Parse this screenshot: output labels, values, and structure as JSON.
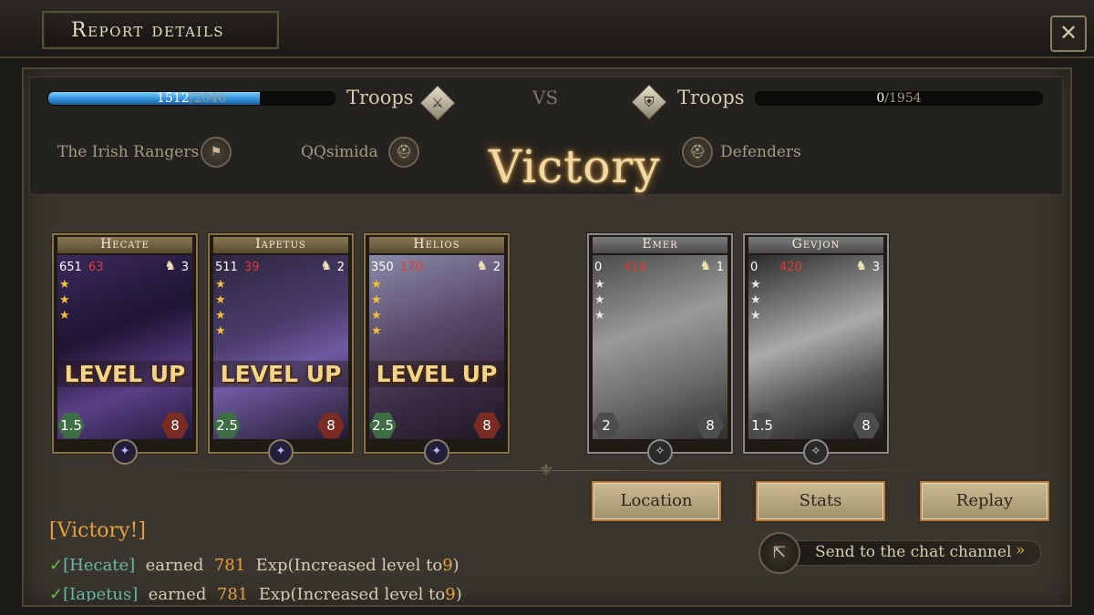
{
  "header": {
    "title": "Report details",
    "close": "✕"
  },
  "battle": {
    "left": {
      "troops_current": "1512",
      "troops_max": "/2046",
      "troops_fraction": 0.739,
      "label": "Troops",
      "icon": "sword-icon"
    },
    "vs": "VS",
    "right": {
      "troops_current": "0",
      "troops_max": "/1954",
      "troops_fraction": 0,
      "label": "Troops",
      "icon": "shield-icon"
    },
    "attacker_guild": "The Irish Rangers",
    "attacker_player": "QQsimida",
    "defender": "Defenders",
    "result": "Victory"
  },
  "cards": [
    {
      "name": "Hecate",
      "hp": "651",
      "loss": "63",
      "count": "3",
      "stars": 3,
      "left_badge": "1.5",
      "right_badge": "8",
      "level_up": "LEVEL UP",
      "gray": false
    },
    {
      "name": "Iapetus",
      "hp": "511",
      "loss": "39",
      "count": "2",
      "stars": 4,
      "left_badge": "2.5",
      "right_badge": "8",
      "level_up": "LEVEL UP",
      "gray": false
    },
    {
      "name": "Helios",
      "hp": "350",
      "loss": "170",
      "count": "2",
      "stars": 4,
      "left_badge": "2.5",
      "right_badge": "8",
      "level_up": "LEVEL UP",
      "gray": false
    },
    {
      "name": "Emer",
      "hp": "0",
      "loss": "414",
      "count": "1",
      "stars": 3,
      "left_badge": "2",
      "right_badge": "8",
      "level_up": "",
      "gray": true
    },
    {
      "name": "Gevjon",
      "hp": "0",
      "loss": "420",
      "count": "3",
      "stars": 3,
      "left_badge": "1.5",
      "right_badge": "8",
      "level_up": "",
      "gray": true
    }
  ],
  "buttons": {
    "location": "Location",
    "stats": "Stats",
    "replay": "Replay"
  },
  "log": {
    "heading": "[Victory!]",
    "lines": [
      {
        "check": "✓",
        "hero": "[Hecate]",
        "verb": "earned",
        "exp": "781",
        "text": "Exp(Increased level to",
        "level": "9",
        "close": ")"
      },
      {
        "check": "✓",
        "hero": "[Iapetus]",
        "verb": "earned",
        "exp": "781",
        "text": "Exp(Increased level to",
        "level": "9",
        "close": ")"
      }
    ]
  },
  "chat": {
    "label": "Send to the chat channel",
    "arrows": "»"
  }
}
